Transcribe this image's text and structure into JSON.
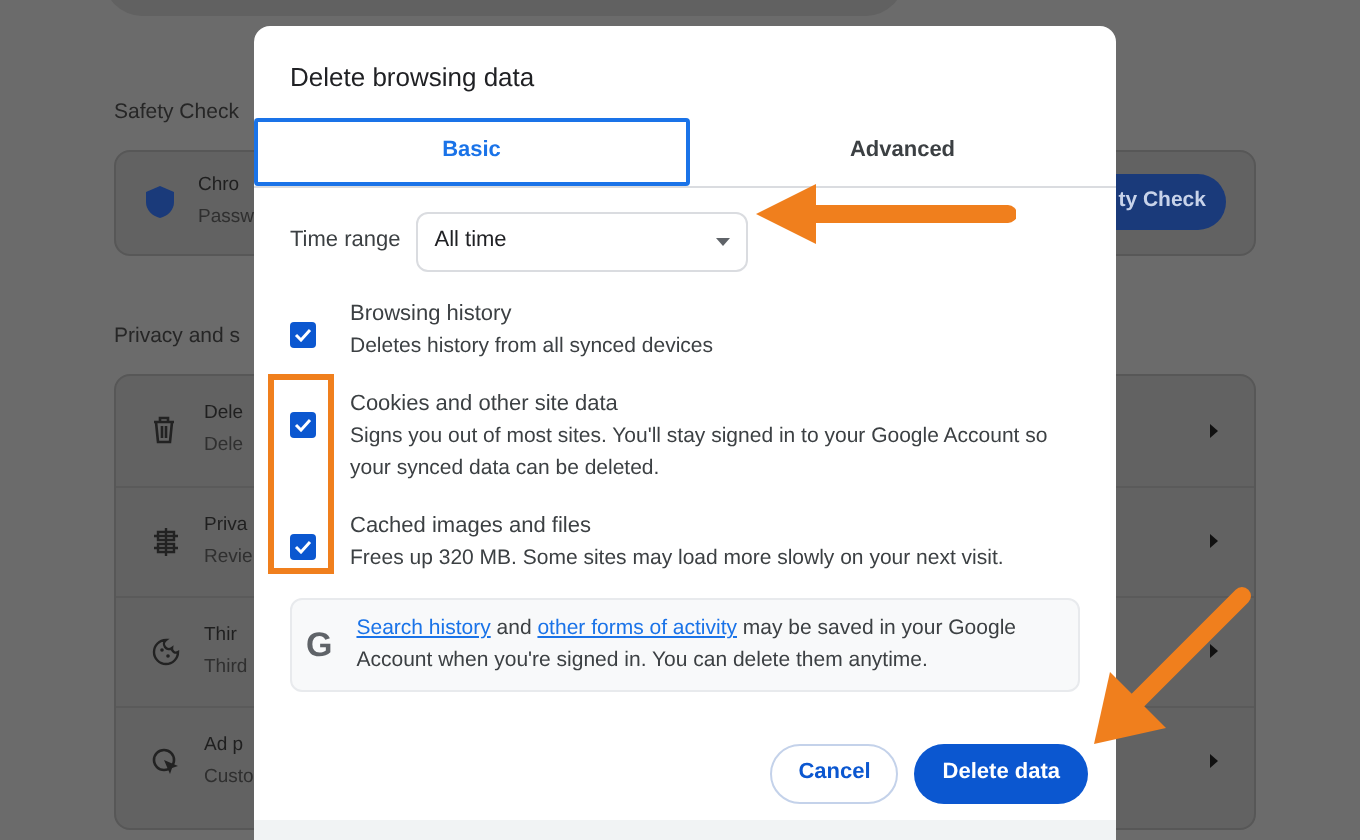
{
  "background": {
    "sections": [
      {
        "title": "Safety Check",
        "rows": [
          {
            "title": "Chro",
            "subtitle": "Passw"
          }
        ],
        "button": "ty Check"
      },
      {
        "title": "Privacy and s",
        "rows": [
          {
            "title": "Dele",
            "subtitle": "Dele"
          },
          {
            "title": "Priva",
            "subtitle": "Revie"
          },
          {
            "title": "Thir",
            "subtitle": "Third"
          },
          {
            "title": "Ad p",
            "subtitle": "Custo"
          }
        ]
      }
    ]
  },
  "dialog": {
    "title": "Delete browsing data",
    "tabs": [
      {
        "label": "Basic",
        "selected": true
      },
      {
        "label": "Advanced",
        "selected": false
      }
    ],
    "time_range": {
      "label": "Time range",
      "value": "All time"
    },
    "options": [
      {
        "title": "Browsing history",
        "description": "Deletes history from all synced devices",
        "checked": true
      },
      {
        "title": "Cookies and other site data",
        "description": "Signs you out of most sites. You'll stay signed in to your Google Account so your synced data can be deleted.",
        "checked": true
      },
      {
        "title": "Cached images and files",
        "description": "Frees up 320 MB. Some sites may load more slowly on your next visit.",
        "checked": true
      }
    ],
    "info": {
      "logo": "G",
      "parts": [
        {
          "kind": "link",
          "text": "Search history"
        },
        {
          "kind": "text",
          "text": " and "
        },
        {
          "kind": "link",
          "text": "other forms of activity"
        },
        {
          "kind": "text",
          "text": " may be saved in your Google Account when you're signed in. You can delete them anytime."
        }
      ]
    },
    "buttons": [
      {
        "label": "Cancel",
        "kind": "secondary"
      },
      {
        "label": "Delete data",
        "kind": "primary"
      }
    ]
  }
}
